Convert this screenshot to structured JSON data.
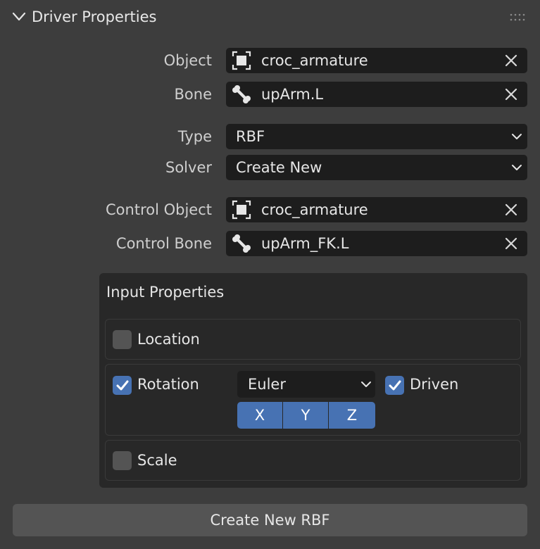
{
  "panel": {
    "title": "Driver Properties"
  },
  "fields": {
    "object": {
      "label": "Object",
      "value": "croc_armature"
    },
    "bone": {
      "label": "Bone",
      "value": "upArm.L"
    },
    "type": {
      "label": "Type",
      "value": "RBF"
    },
    "solver": {
      "label": "Solver",
      "value": "Create New"
    },
    "control_object": {
      "label": "Control Object",
      "value": "croc_armature"
    },
    "control_bone": {
      "label": "Control Bone",
      "value": "upArm_FK.L"
    }
  },
  "input": {
    "title": "Input Properties",
    "location": {
      "label": "Location",
      "checked": false
    },
    "rotation": {
      "label": "Rotation",
      "checked": true,
      "mode": "Euler",
      "axes": [
        "X",
        "Y",
        "Z"
      ]
    },
    "driven": {
      "label": "Driven",
      "checked": true
    },
    "scale": {
      "label": "Scale",
      "checked": false
    }
  },
  "button": {
    "label": "Create New RBF"
  },
  "colors": {
    "accent": "#4772b3",
    "field_bg": "#1d1d1d",
    "panel_bg": "#3d3d3d"
  },
  "icons": [
    "chevron-down-icon",
    "grip-icon",
    "object-icon",
    "bone-icon",
    "close-icon",
    "dropdown-icon",
    "checkmark-icon"
  ]
}
